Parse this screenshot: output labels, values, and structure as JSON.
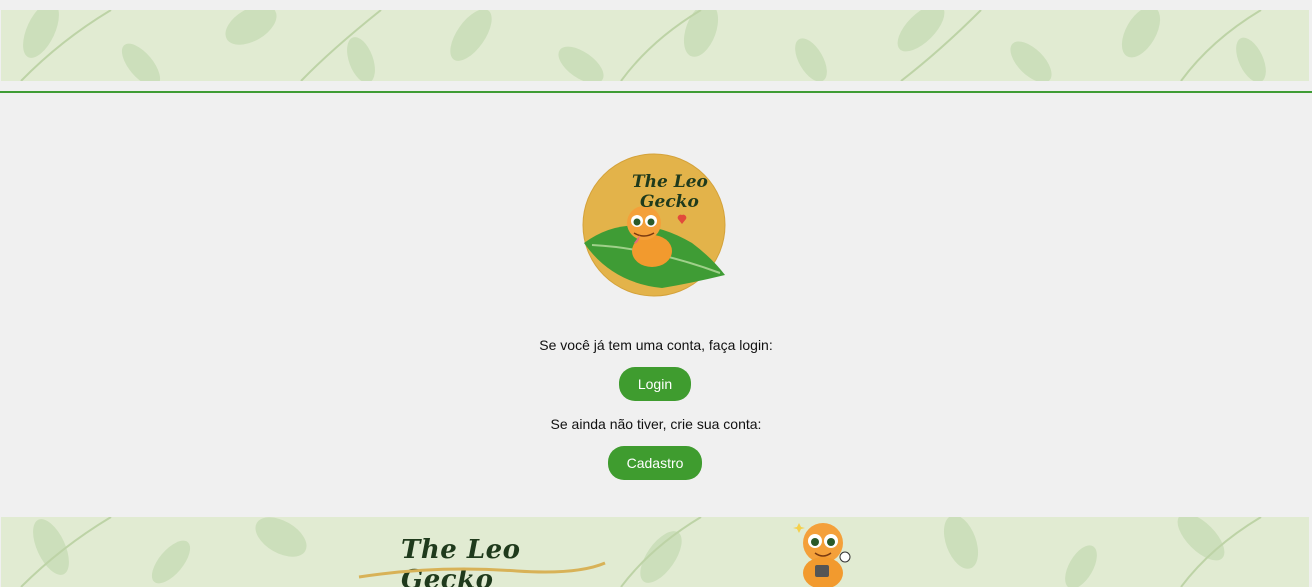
{
  "brand": {
    "name": "The Leo Gecko",
    "logo_line1": "The Leo",
    "logo_line2": "Gecko"
  },
  "prompts": {
    "has_account": "Se você já tem uma conta, faça login:",
    "no_account": "Se ainda não tiver, crie sua conta:"
  },
  "buttons": {
    "login_label": "Login",
    "signup_label": "Cadastro"
  },
  "colors": {
    "accent": "#3f9c2f",
    "band": "#e1ebd2",
    "leaf": "#c6dcb2",
    "page_bg": "#f0f0f0",
    "logo_circle": "#e3b34a"
  },
  "icons": {
    "logo": "gecko-on-leaf-logo",
    "mascot": "gecko-mascot-icon",
    "pattern": "leaf-pattern"
  }
}
